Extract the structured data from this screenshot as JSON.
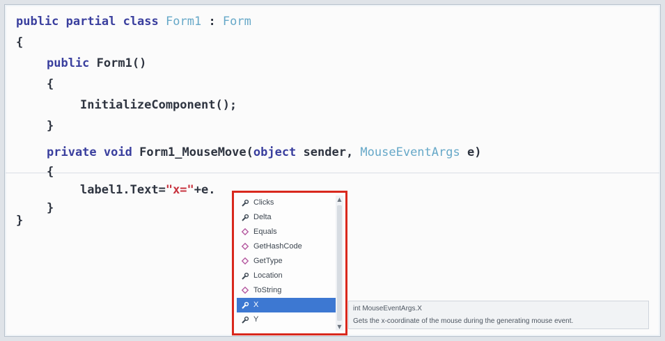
{
  "code": {
    "line1": {
      "kw1": "public",
      "kw2": "partial",
      "kw3": "class",
      "type1": "Form1",
      "sep": " : ",
      "type2": "Form"
    },
    "line2": "{",
    "line3": {
      "kw": "public",
      "rest": "Form1()"
    },
    "line4": "{",
    "line5": "InitializeComponent();",
    "line6": "}",
    "line7": {
      "kw1": "private",
      "kw2": "void",
      "name": "Form1_MouseMove(",
      "kw3": "object",
      "param1": " sender, ",
      "type": "MouseEventArgs",
      "param2": " e)"
    },
    "line8": "{",
    "line9": {
      "prefix": "label1.Text=",
      "string": "\"x=\"",
      "suffix": "+e."
    },
    "line10": "}",
    "line11": "}"
  },
  "intellisense": {
    "items": [
      {
        "label": "Clicks",
        "icon": "wrench-property-icon"
      },
      {
        "label": "Delta",
        "icon": "wrench-property-icon"
      },
      {
        "label": "Equals",
        "icon": "method-icon"
      },
      {
        "label": "GetHashCode",
        "icon": "method-icon"
      },
      {
        "label": "GetType",
        "icon": "method-icon"
      },
      {
        "label": "Location",
        "icon": "wrench-property-icon"
      },
      {
        "label": "ToString",
        "icon": "method-icon"
      },
      {
        "label": "X",
        "icon": "wrench-property-icon",
        "selected": true
      },
      {
        "label": "Y",
        "icon": "wrench-property-icon"
      }
    ],
    "highlight_color": "#d9281d",
    "selection_color": "#3d78d2"
  },
  "tooltip": {
    "signature": "int MouseEventArgs.X",
    "description": "Gets the x-coordinate of the mouse during the generating mouse event."
  }
}
